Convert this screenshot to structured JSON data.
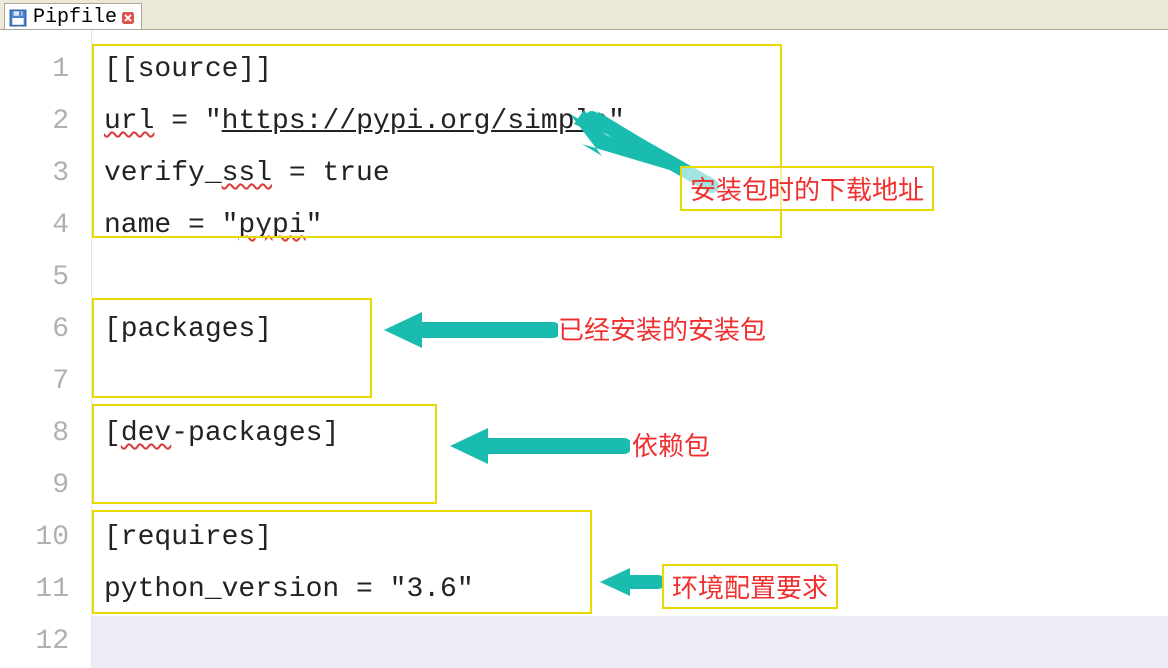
{
  "tab": {
    "filename": "Pipfile"
  },
  "line_numbers": [
    "1",
    "2",
    "3",
    "4",
    "5",
    "6",
    "7",
    "8",
    "9",
    "10",
    "11",
    "12"
  ],
  "code": {
    "l1": "[[source]]",
    "l2a": "url",
    "l2b": " = \"",
    "l2c": "https://pypi.org/simple",
    "l2d": "\"",
    "l3a": "verify_",
    "l3b": "ssl",
    "l3c": " = true",
    "l4a": "name = \"",
    "l4b": "pypi",
    "l4c": "\"",
    "l6": "[packages]",
    "l8": "[dev-packages]",
    "l10": "[requires]",
    "l11": "python_version = \"3.6\""
  },
  "annotations": {
    "a1": "安装包时的下载地址",
    "a2": "已经安装的安装包",
    "a3": "依赖包",
    "a4": "环境配置要求"
  }
}
